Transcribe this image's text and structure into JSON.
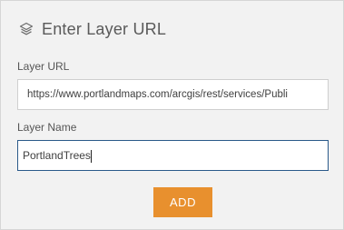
{
  "header": {
    "title": "Enter Layer URL",
    "icon": "layers-icon"
  },
  "form": {
    "url_label": "Layer URL",
    "url_value": "https://www.portlandmaps.com/arcgis/rest/services/Publi",
    "name_label": "Layer Name",
    "name_value": "PortlandTrees"
  },
  "actions": {
    "add_label": "ADD"
  },
  "colors": {
    "accent": "#e8902e",
    "focus_border": "#2b5a8a"
  }
}
